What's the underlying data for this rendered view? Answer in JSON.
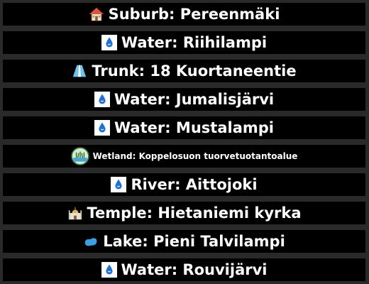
{
  "items": [
    {
      "icon": "house-icon",
      "label": "Suburb: Pereenmäki"
    },
    {
      "icon": "water-drop-icon",
      "label": "Water: Riihilampi"
    },
    {
      "icon": "road-icon",
      "label": "Trunk: 18 Kuortaneentie"
    },
    {
      "icon": "water-drop-icon",
      "label": "Water: Jumalisjärvi"
    },
    {
      "icon": "water-drop-icon",
      "label": "Water: Mustalampi"
    },
    {
      "icon": "wetland-icon",
      "label": "Wetland: Koppelosuon tuorvetuotantoalue"
    },
    {
      "icon": "water-drop-icon",
      "label": "River: Aittojoki"
    },
    {
      "icon": "temple-icon",
      "label": "Temple: Hietaniemi kyrka"
    },
    {
      "icon": "lake-icon",
      "label": "Lake: Pieni Talvilampi"
    },
    {
      "icon": "water-drop-icon",
      "label": "Water: Rouvijärvi"
    }
  ],
  "colors": {
    "background": "#2a2a2a",
    "row": "#000000",
    "text": "#ffffff"
  }
}
